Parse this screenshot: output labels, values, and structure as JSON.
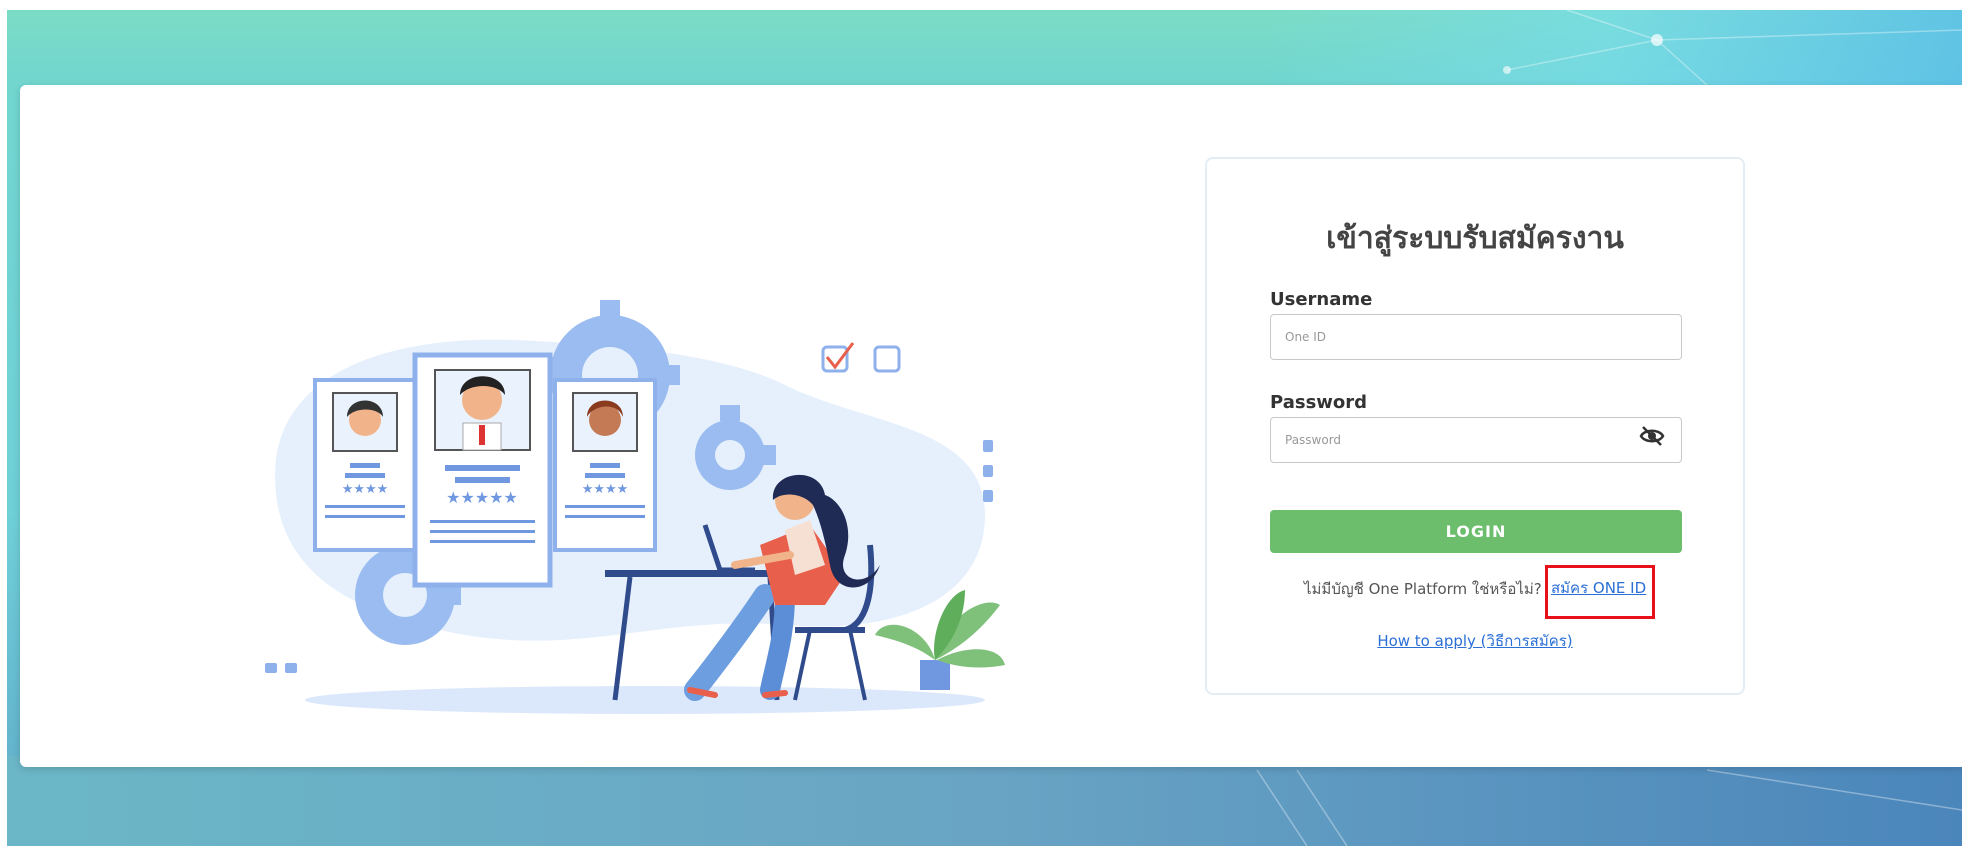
{
  "login": {
    "title": "เข้าสู่ระบบรับสมัครงาน",
    "username_label": "Username",
    "username_placeholder": "One ID",
    "password_label": "Password",
    "password_placeholder": "Password",
    "login_button": "LOGIN",
    "no_account_text": "ไม่มีบัญชี One Platform ใช่หรือไม่?",
    "signup_link": "สมัคร ONE ID",
    "howto_link": "How to apply (วิธีการสมัคร)"
  },
  "icons": {
    "password_toggle": "eye-slash-icon"
  },
  "colors": {
    "login_button": "#6cbd6c",
    "link": "#2a6fd6",
    "highlight": "#e8101a",
    "background_gradient_start": "#7bdcc4",
    "background_gradient_end": "#4b86bb"
  }
}
